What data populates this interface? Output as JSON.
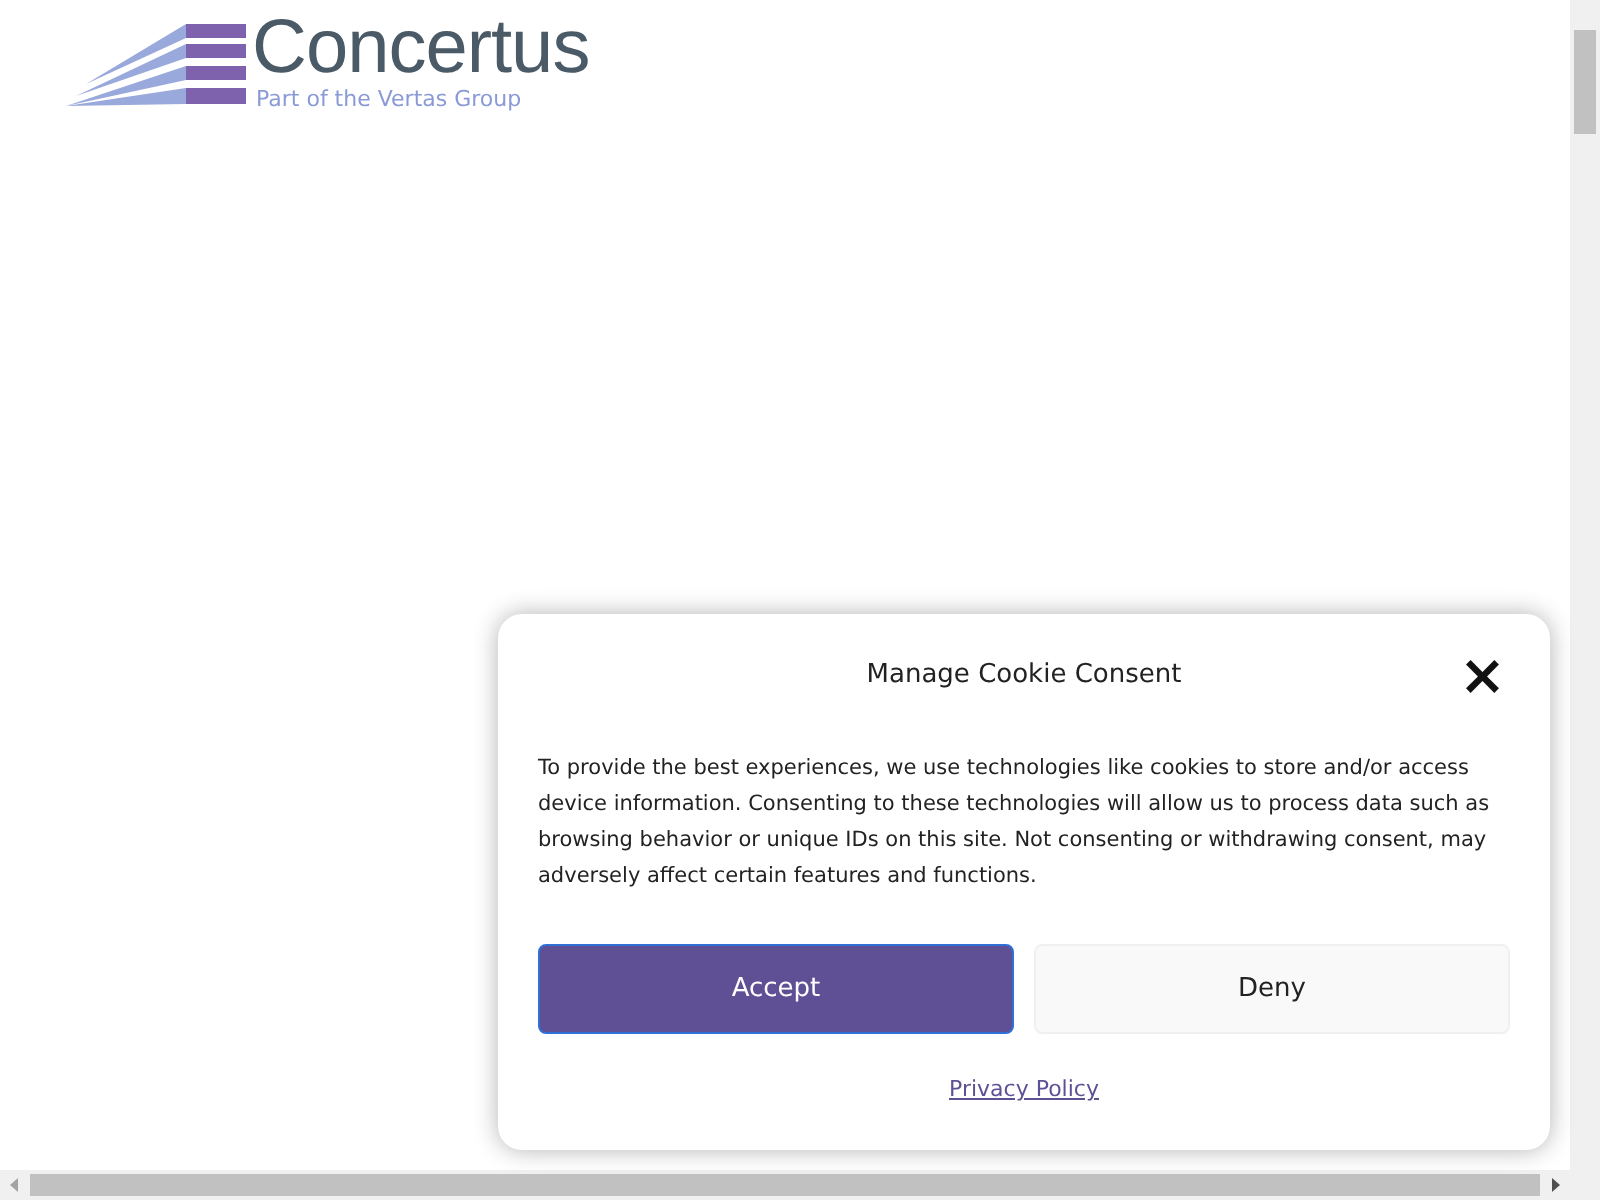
{
  "logo": {
    "name": "Concertus",
    "tagline": "Part of the Vertas Group"
  },
  "cookie_dialog": {
    "title": "Manage Cookie Consent",
    "close": "×",
    "body": "To provide the best experiences, we use technologies like cookies to store and/or access device information. Consenting to these technologies will allow us to process data such as browsing behavior or unique IDs on this site. Not consenting or withdrawing consent, may adversely affect certain features and functions.",
    "buttons": [
      {
        "label": "Accept",
        "kind": "primary"
      },
      {
        "label": "Deny",
        "kind": "secondary"
      }
    ],
    "link": "Privacy Policy"
  }
}
